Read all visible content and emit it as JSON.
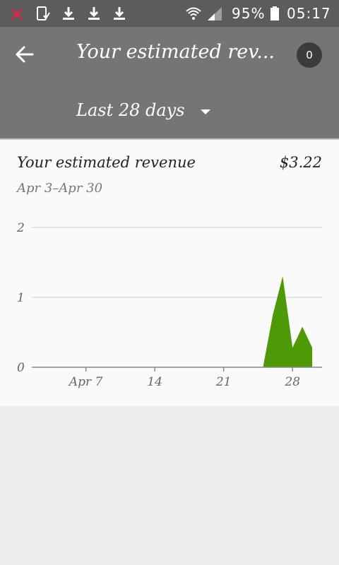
{
  "status_bar": {
    "battery_text": "95%",
    "time": "05:17",
    "icons": [
      "close-notification-icon",
      "screenshot-icon",
      "download-icon",
      "download-icon",
      "download-icon",
      "wifi-icon",
      "signal-icon",
      "battery-icon"
    ]
  },
  "app_bar": {
    "title": "Your estimated rev...",
    "badge_count": "0",
    "range_label": "Last 28 days",
    "background": "#757575",
    "status_bar_background": "#5c5c5c"
  },
  "card": {
    "title": "Your estimated revenue",
    "value": "$3.22",
    "subtitle": "Apr 3–Apr 30"
  },
  "chart_data": {
    "type": "area",
    "title": "",
    "xlabel": "",
    "ylabel": "",
    "y_ticks": [
      "0",
      "1",
      "2"
    ],
    "ylim": [
      0,
      2
    ],
    "x_ticks": [
      "Apr 7",
      "14",
      "21",
      "28"
    ],
    "x_tick_days": [
      7,
      14,
      21,
      28
    ],
    "xlim": [
      1.5,
      31
    ],
    "grid": true,
    "color": "#4e9a06",
    "series": [
      {
        "x": [
          3,
          4,
          5,
          6,
          7,
          8,
          9,
          10,
          11,
          12,
          13,
          14,
          15,
          16,
          17,
          18,
          19,
          20,
          21,
          22,
          23,
          24,
          25,
          26,
          27,
          28,
          29,
          30
        ],
        "y": [
          0,
          0,
          0,
          0,
          0,
          0,
          0,
          0,
          0,
          0,
          0,
          0,
          0,
          0,
          0,
          0,
          0,
          0,
          0,
          0,
          0,
          0,
          0,
          0.75,
          1.3,
          0.28,
          0.58,
          0.28
        ]
      }
    ]
  }
}
